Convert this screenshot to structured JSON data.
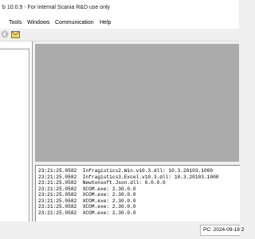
{
  "window": {
    "title": "b 10.0.9 - For internal Scania R&D use only"
  },
  "menu": {
    "items": [
      {
        "label": "Tools"
      },
      {
        "label": "Windows"
      },
      {
        "label": "Communication"
      },
      {
        "label": "Help"
      }
    ]
  },
  "toolbar": {
    "icons": [
      "back-icon",
      "mail-icon"
    ]
  },
  "log": {
    "rows": [
      {
        "time": "23:21:25.0582",
        "message": "Infragistics2.Win.v10.3.dll: 10.3.20103.1000"
      },
      {
        "time": "23:21:25.0582",
        "message": "Infragistics3.Excel.v10.3.dll: 10.3.20103.1000"
      },
      {
        "time": "23:21:25.0582",
        "message": "Newtonsoft.Json.dll: 6.0.0.0"
      },
      {
        "time": "23:21:25.0582",
        "message": "XCOM.exe: 2.30.0.0"
      },
      {
        "time": "23:21:25.0582",
        "message": "XCOM.exe: 2.30.0.0"
      },
      {
        "time": "23:21:25.0582",
        "message": "XCOM.exe: 2.30.0.0"
      },
      {
        "time": "23:21:25.0582",
        "message": "XCOM.exe: 2.30.0.0"
      },
      {
        "time": "23:21:25.0582",
        "message": "XCOM.exe: 2.30.0.0"
      }
    ]
  },
  "status": {
    "text": "PC: 2024-09-18 2"
  },
  "colors": {
    "workspace": "#ababab",
    "mail_icon": "#d4a017"
  }
}
